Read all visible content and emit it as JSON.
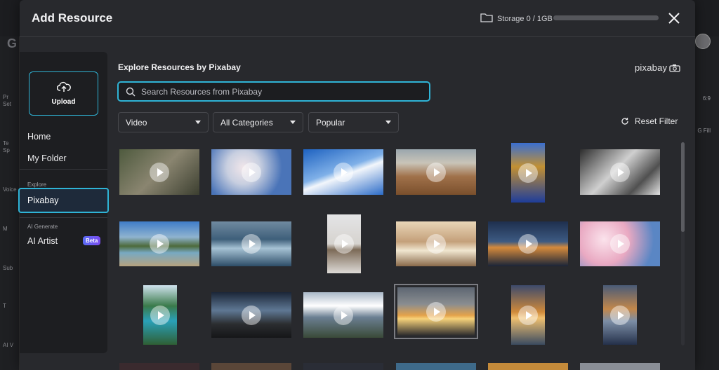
{
  "background": {
    "logo": "G",
    "left_items": [
      "Pr",
      "Set",
      "Te",
      "Sp",
      "Voice",
      "M",
      "Sub",
      "T",
      "AI V"
    ],
    "right_items": [
      "6:9",
      "G Fill"
    ]
  },
  "modal": {
    "title": "Add Resource",
    "storage": {
      "label": "Storage 0 / 1GB",
      "used_fraction": 0.0
    }
  },
  "sidebar": {
    "upload_label": "Upload",
    "items": {
      "home": "Home",
      "my_folder": "My Folder"
    },
    "explore_section": "Explore",
    "explore_item": "Pixabay",
    "ai_section": "AI Generate",
    "ai_item": "AI Artist",
    "beta_badge": "Beta"
  },
  "content": {
    "title": "Explore Resources by Pixabay",
    "brand": "pixabay",
    "search_placeholder": "Search Resources from Pixabay",
    "filters": {
      "type": "Video",
      "category": "All Categories",
      "sort": "Popular"
    },
    "reset_label": "Reset Filter"
  },
  "thumbnails": [
    {
      "name": "monkeys"
    },
    {
      "name": "cherry-blossom-sky"
    },
    {
      "name": "blue-sky-clouds"
    },
    {
      "name": "beach-waves"
    },
    {
      "name": "underwater-coral"
    },
    {
      "name": "snowy-rail"
    },
    {
      "name": "mountain-lake"
    },
    {
      "name": "ocean-waves"
    },
    {
      "name": "horses-snow"
    },
    {
      "name": "open-book-beach"
    },
    {
      "name": "sunset-horizon"
    },
    {
      "name": "pink-blossoms"
    },
    {
      "name": "heart-lake"
    },
    {
      "name": "night-mountains"
    },
    {
      "name": "cloudy-mountains"
    },
    {
      "name": "birds-sunset"
    },
    {
      "name": "beach-sunset-vertical"
    },
    {
      "name": "sunset-clouds-vertical"
    }
  ]
}
